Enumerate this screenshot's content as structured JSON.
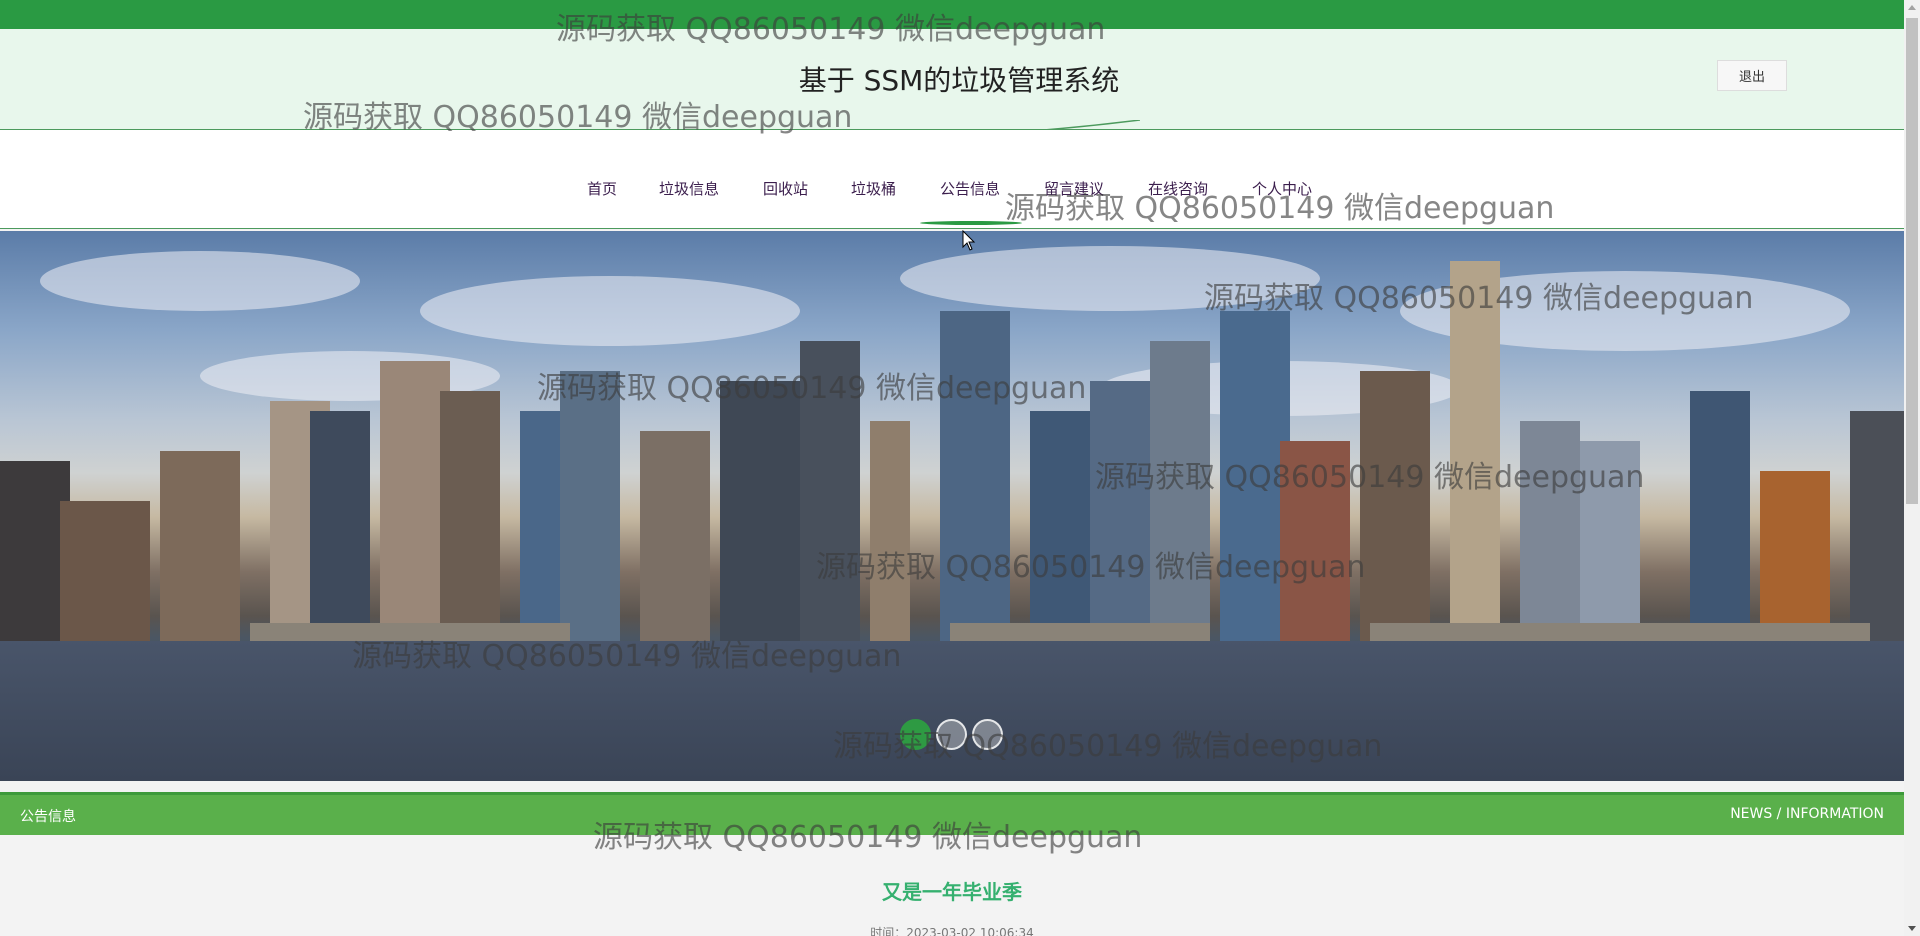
{
  "header": {
    "title": "基于 SSM的垃圾管理系统",
    "logout_label": "退出"
  },
  "nav": {
    "items": [
      {
        "label": "首页"
      },
      {
        "label": "垃圾信息"
      },
      {
        "label": "回收站"
      },
      {
        "label": "垃圾桶"
      },
      {
        "label": "公告信息"
      },
      {
        "label": "留言建议"
      },
      {
        "label": "在线咨询"
      },
      {
        "label": "个人中心"
      }
    ],
    "active_index": 4
  },
  "banner": {
    "slide_count": 3,
    "active_slide": 1
  },
  "section": {
    "title": "公告信息",
    "subtitle": "NEWS / INFORMATION"
  },
  "article": {
    "title": "又是一年毕业季",
    "time": "时间：2023-03-02 10:06:34"
  },
  "watermark": {
    "text": "源码获取 QQ86050149 微信deepguan"
  },
  "colors": {
    "brand_green": "#2a9a43",
    "section_green": "#5ab04b",
    "header_bg": "#e8f7ec",
    "article_title": "#35b06f"
  }
}
